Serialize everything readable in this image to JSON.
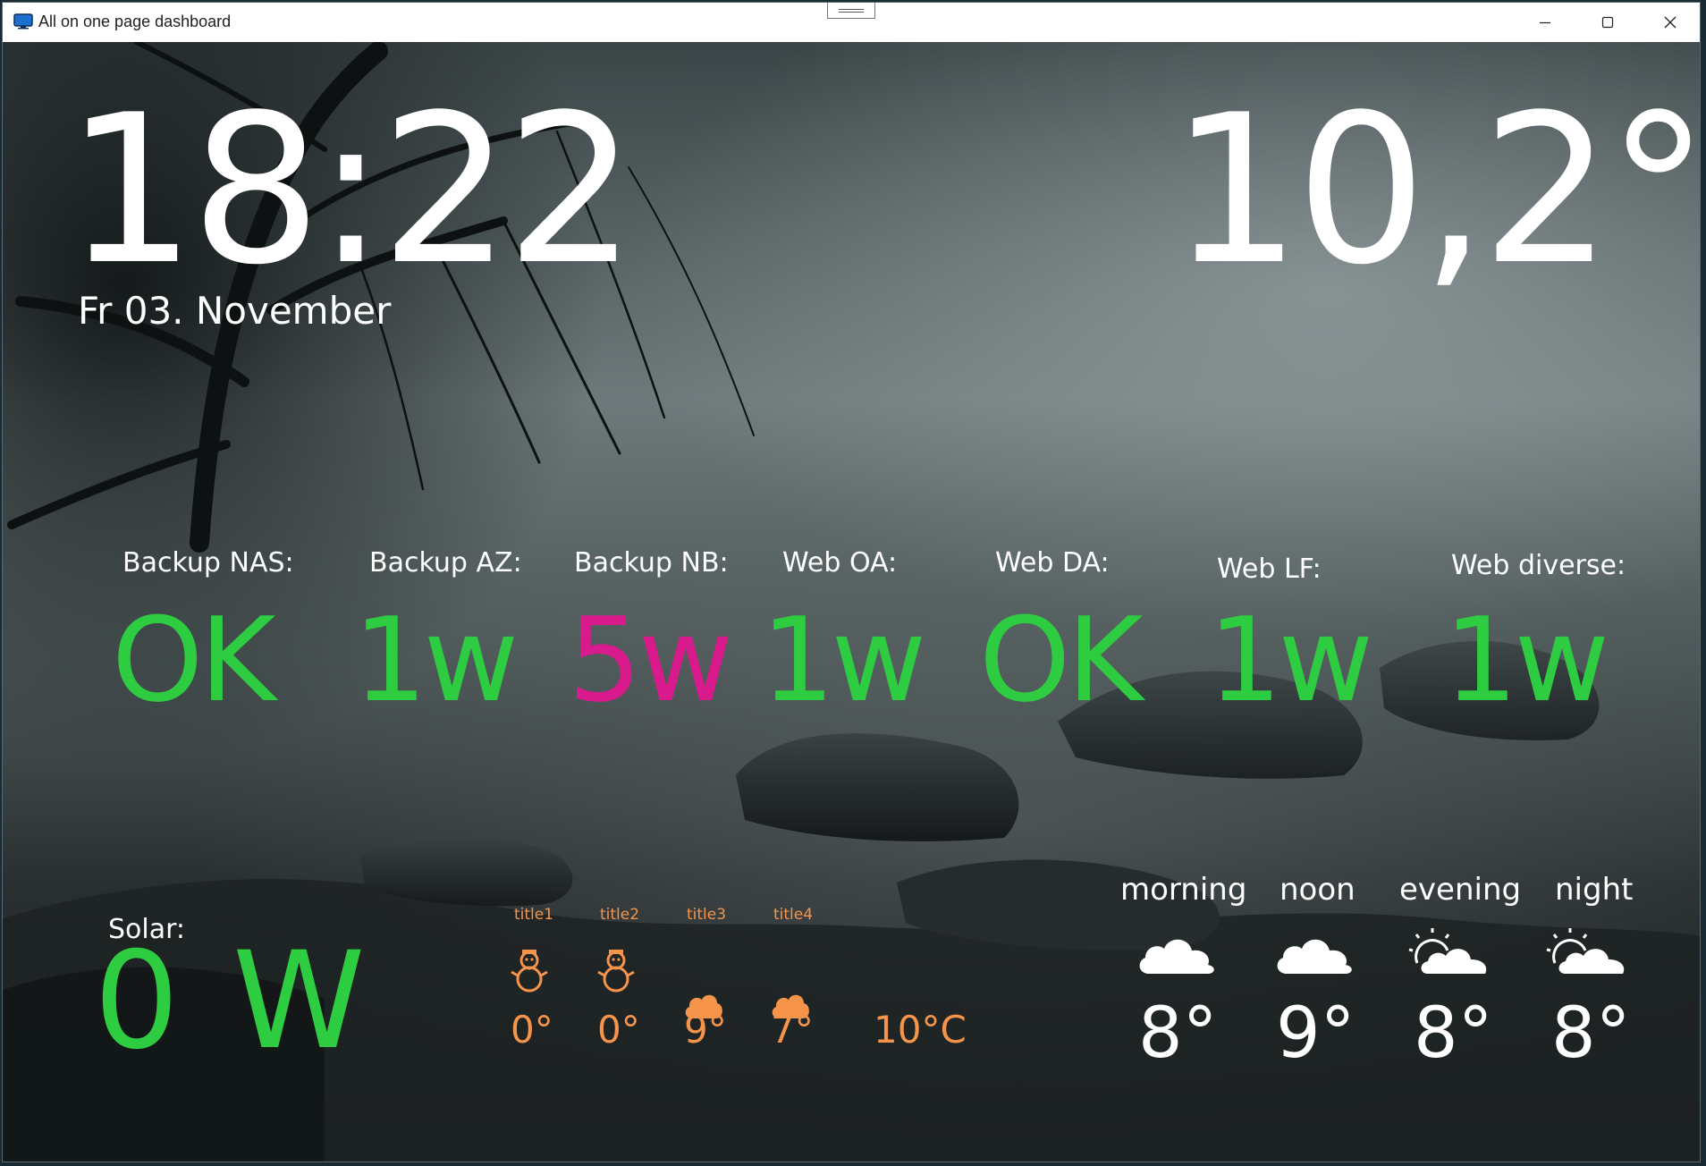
{
  "window": {
    "title": "All on one page dashboard"
  },
  "clock": {
    "time": "18:22",
    "date": "Fr 03. November"
  },
  "weather_now": {
    "temperature": "10,2°"
  },
  "status": [
    {
      "label": "Backup NAS:",
      "value": "OK",
      "color": "#2ecc40"
    },
    {
      "label": "Backup AZ:",
      "value": "1w",
      "color": "#2ecc40"
    },
    {
      "label": "Backup NB:",
      "value": "5w",
      "color": "#d91a8c"
    },
    {
      "label": "Web OA:",
      "value": "1w",
      "color": "#2ecc40"
    },
    {
      "label": "Web DA:",
      "value": "OK",
      "color": "#2ecc40"
    },
    {
      "label": "Web LF:",
      "value": "1w",
      "color": "#2ecc40"
    },
    {
      "label": "Web diverse:",
      "value": "1w",
      "color": "#2ecc40"
    }
  ],
  "solar": {
    "label": "Solar:",
    "value": "0 W"
  },
  "forecast": {
    "color": "#f5944a",
    "items": [
      {
        "title": "title1",
        "icon": "snowman-icon",
        "temp": "0°"
      },
      {
        "title": "title2",
        "icon": "snowman-icon",
        "temp": "0°"
      },
      {
        "title": "title3",
        "icon": "cloud-icon",
        "temp": "9°"
      },
      {
        "title": "title4",
        "icon": "cloud-icon",
        "temp": "7°"
      }
    ],
    "extra_temp": "10°C"
  },
  "day_forecast": [
    {
      "label": "morning",
      "icon": "cloud-icon",
      "temp": "8°"
    },
    {
      "label": "noon",
      "icon": "cloud-icon",
      "temp": "9°"
    },
    {
      "label": "evening",
      "icon": "partly-cloudy-icon",
      "temp": "8°"
    },
    {
      "label": "night",
      "icon": "partly-cloudy-icon",
      "temp": "8°"
    }
  ]
}
